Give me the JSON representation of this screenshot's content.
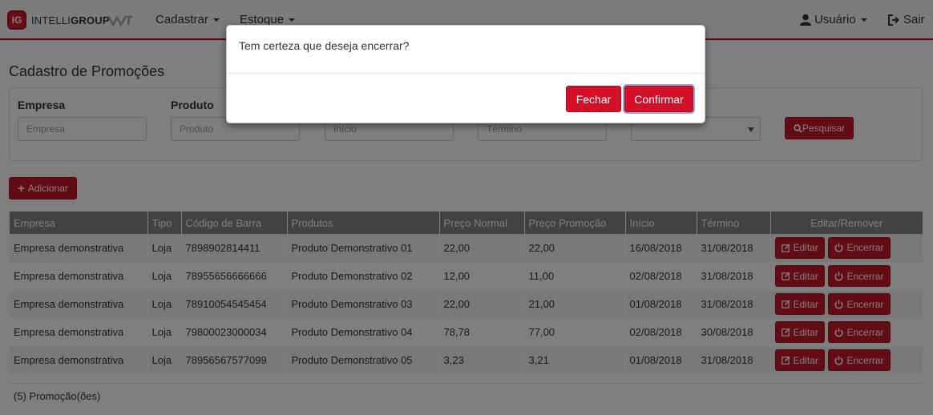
{
  "navbar": {
    "brand_badge": "IG",
    "brand_prefix": "INTELLI",
    "brand_suffix": "GROUP",
    "menu_cadastrar": "Cadastrar",
    "menu_estoque": "Estoque",
    "user_label": "Usuário",
    "exit_label": "Sair",
    "accent_color": "#c00018"
  },
  "page": {
    "title": "Cadastro de Promoções"
  },
  "filters": {
    "empresa_label": "Empresa",
    "empresa_placeholder": "Empresa",
    "produto_label": "Produto",
    "produto_placeholder": "Produto",
    "inicio_placeholder": "Início",
    "termino_placeholder": "Término",
    "search_label": "Pesquisar"
  },
  "actions": {
    "add_label": "Adicionar"
  },
  "table": {
    "headers": [
      "Empresa",
      "Tipo",
      "Código de Barra",
      "Produtos",
      "Preço Normal",
      "Preço Promoção",
      "Início",
      "Término",
      "Editar/Remover"
    ],
    "rows": [
      {
        "empresa": "Empresa demonstrativa",
        "tipo": "Loja",
        "codigo": "7898902814411",
        "produto": "Produto Demonstrativo 01",
        "preco_normal": "22,00",
        "preco_promocao": "22,00",
        "inicio": "16/08/2018",
        "termino": "31/08/2018"
      },
      {
        "empresa": "Empresa demonstrativa",
        "tipo": "Loja",
        "codigo": "78955656666666",
        "produto": "Produto Demonstrativo 02",
        "preco_normal": "12,00",
        "preco_promocao": "11,00",
        "inicio": "02/08/2018",
        "termino": "31/08/2018"
      },
      {
        "empresa": "Empresa demonstrativa",
        "tipo": "Loja",
        "codigo": "78910054545454",
        "produto": "Produto Demonstrativo 03",
        "preco_normal": "22,00",
        "preco_promocao": "21,00",
        "inicio": "01/08/2018",
        "termino": "31/08/2018"
      },
      {
        "empresa": "Empresa demonstrativa",
        "tipo": "Loja",
        "codigo": "79800023000034",
        "produto": "Produto Demonstrativo 04",
        "preco_normal": "78,78",
        "preco_promocao": "77,00",
        "inicio": "02/08/2018",
        "termino": "30/08/2018"
      },
      {
        "empresa": "Empresa demonstrativa",
        "tipo": "Loja",
        "codigo": "78956567577099",
        "produto": "Produto Demonstrativo 05",
        "preco_normal": "3,23",
        "preco_promocao": "3,21",
        "inicio": "01/08/2018",
        "termino": "31/08/2018"
      }
    ],
    "edit_label": "Editar",
    "end_label": "Encerrar"
  },
  "footer": {
    "count_label": "(5) Promoção(ões)"
  },
  "modal": {
    "message": "Tem certeza que deseja encerrar?",
    "close_label": "Fechar",
    "confirm_label": "Confirmar"
  }
}
